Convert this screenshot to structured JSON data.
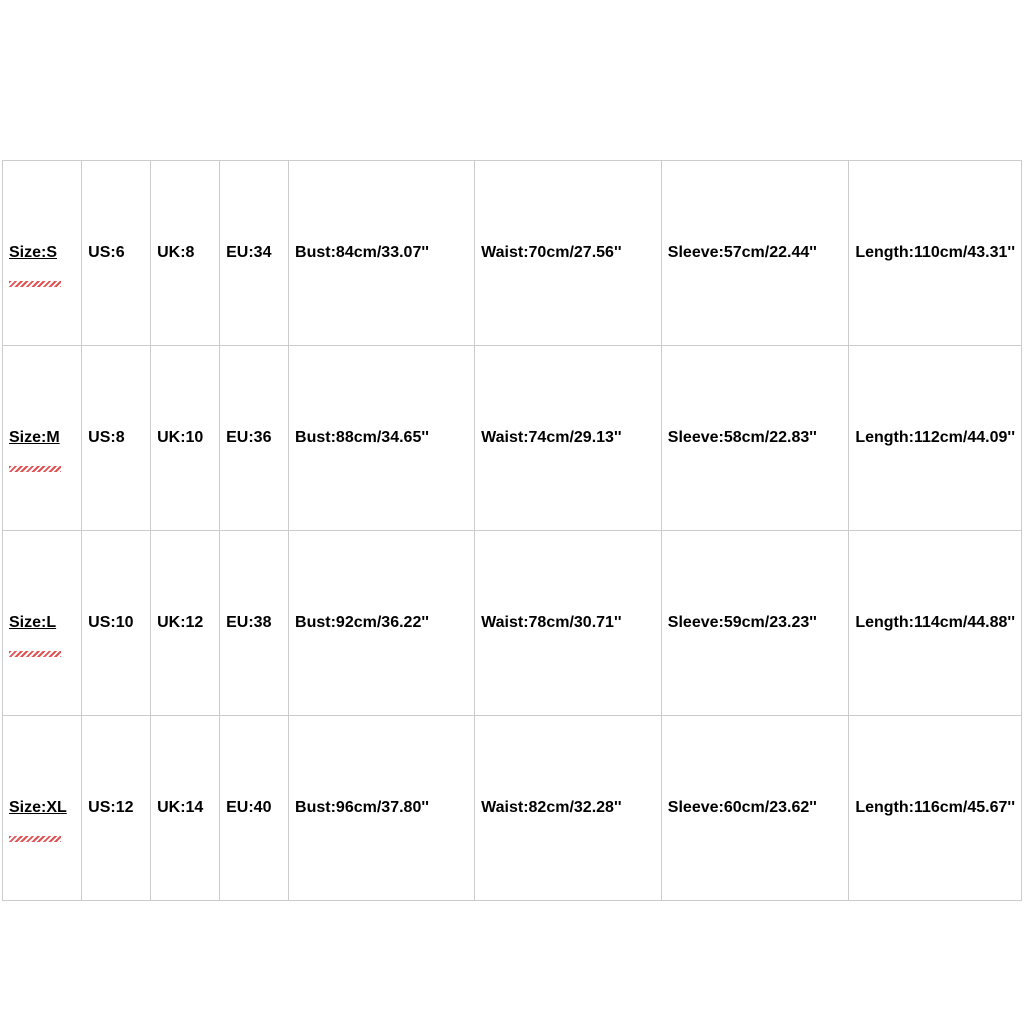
{
  "chart_data": {
    "type": "table",
    "columns": [
      "Size",
      "US",
      "UK",
      "EU",
      "Bust",
      "Waist",
      "Sleeve",
      "Length"
    ],
    "rows": [
      {
        "Size": "S",
        "US": "6",
        "UK": "8",
        "EU": "34",
        "Bust_cm": 84,
        "Bust_in": 33.07,
        "Waist_cm": 70,
        "Waist_in": 27.56,
        "Sleeve_cm": 57,
        "Sleeve_in": 22.44,
        "Length_cm": 110,
        "Length_in": 43.31
      },
      {
        "Size": "M",
        "US": "8",
        "UK": "10",
        "EU": "36",
        "Bust_cm": 88,
        "Bust_in": 34.65,
        "Waist_cm": 74,
        "Waist_in": 29.13,
        "Sleeve_cm": 58,
        "Sleeve_in": 22.83,
        "Length_cm": 112,
        "Length_in": 44.09
      },
      {
        "Size": "L",
        "US": "10",
        "UK": "12",
        "EU": "38",
        "Bust_cm": 92,
        "Bust_in": 36.22,
        "Waist_cm": 78,
        "Waist_in": 30.71,
        "Sleeve_cm": 59,
        "Sleeve_in": 23.23,
        "Length_cm": 114,
        "Length_in": 44.88
      },
      {
        "Size": "XL",
        "US": "12",
        "UK": "14",
        "EU": "40",
        "Bust_cm": 96,
        "Bust_in": 37.8,
        "Waist_cm": 82,
        "Waist_in": 32.28,
        "Sleeve_cm": 60,
        "Sleeve_in": 23.62,
        "Length_cm": 116,
        "Length_in": 45.67
      }
    ]
  },
  "cells": {
    "r0": {
      "size": "Size:S",
      "us": "US:6",
      "uk": "UK:8",
      "eu": "EU:34",
      "bust": "Bust:84cm/33.07''",
      "waist": "Waist:70cm/27.56''",
      "sleeve": "Sleeve:57cm/22.44''",
      "length": "Length:110cm/43.31''"
    },
    "r1": {
      "size": "Size:M",
      "us": "US:8",
      "uk": "UK:10",
      "eu": "EU:36",
      "bust": "Bust:88cm/34.65''",
      "waist": "Waist:74cm/29.13''",
      "sleeve": "Sleeve:58cm/22.83''",
      "length": "Length:112cm/44.09''"
    },
    "r2": {
      "size": "Size:L",
      "us": "US:10",
      "uk": "UK:12",
      "eu": "EU:38",
      "bust": "Bust:92cm/36.22''",
      "waist": "Waist:78cm/30.71''",
      "sleeve": "Sleeve:59cm/23.23''",
      "length": "Length:114cm/44.88''"
    },
    "r3": {
      "size": "Size:XL",
      "us": "US:12",
      "uk": "UK:14",
      "eu": "EU:40",
      "bust": "Bust:96cm/37.80''",
      "waist": "Waist:82cm/32.28''",
      "sleeve": "Sleeve:60cm/23.62''",
      "length": "Length:116cm/45.67''"
    }
  }
}
